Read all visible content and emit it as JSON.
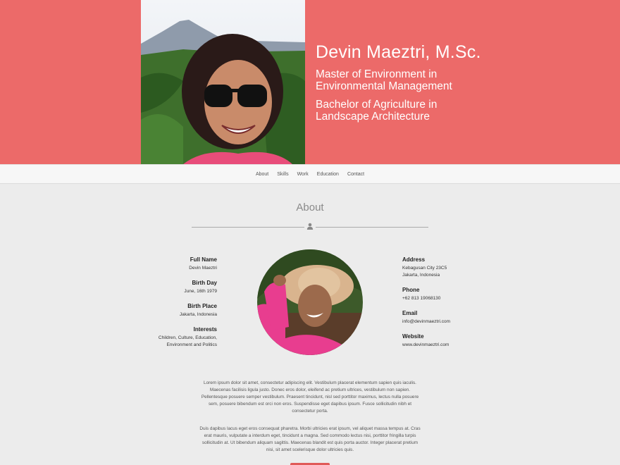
{
  "header": {
    "name": "Devin Maeztri, M.Sc.",
    "degrees": [
      "Master of Environment in Environmental Management",
      "Bachelor of Agriculture in Landscape Architecture"
    ],
    "accent_color": "#ec6a69"
  },
  "nav": {
    "items": [
      "About",
      "Skills",
      "Work",
      "Education",
      "Contact"
    ]
  },
  "about": {
    "title": "About",
    "divider_icon": "person-icon",
    "left_fields": [
      {
        "label": "Full Name",
        "value": "Devin Maeztri"
      },
      {
        "label": "Birth Day",
        "value": "June, 16th 1979"
      },
      {
        "label": "Birth Place",
        "value": "Jakarta, Indonesia"
      },
      {
        "label": "Interests",
        "value": "Children, Culture, Education, Environment and Politics"
      }
    ],
    "right_fields": [
      {
        "label": "Address",
        "value": "Kebagusan City 23C5 Jakarta, Indonesia"
      },
      {
        "label": "Phone",
        "value": "+62 813 19068130"
      },
      {
        "label": "Email",
        "value": "info@devinmaeztri.com"
      },
      {
        "label": "Website",
        "value": "www.devinmaeztri.com"
      }
    ],
    "bio": [
      "Lorem ipsum dolor sit amet, consectetur adipiscing elit. Vestibulum placerat elementum sapien quis iaculis. Maecenas facilisis ligula justo. Donec eros dolor, eleifend ac pretium ultrices, vestibulum non sapien. Pellentesque posuere semper vestibulum. Praesent tincidunt, nisl sed porttitor maximus, lectus nulla posuere sem, posuere bibendum est orci non eros. Suspendisse eget dapibus ipsum. Fusce sollicitudin nibh et consectetur porta.",
      "Duis dapibus lacus eget eros consequat pharetra. Morbi ultricies erat ipsum, vel aliquet massa tempus at. Cras erat mauris, vulputate a interdum eget, tincidunt a magna. Sed commodo lectus nisi, porttitor fringilla turpis sollicitudin at. Ut bibendum aliquam sagittis. Maecenas blandit est quis porta auctor. Integer placerat pretium nisi, sit amet scelerisque dolor ultricies quis."
    ]
  }
}
